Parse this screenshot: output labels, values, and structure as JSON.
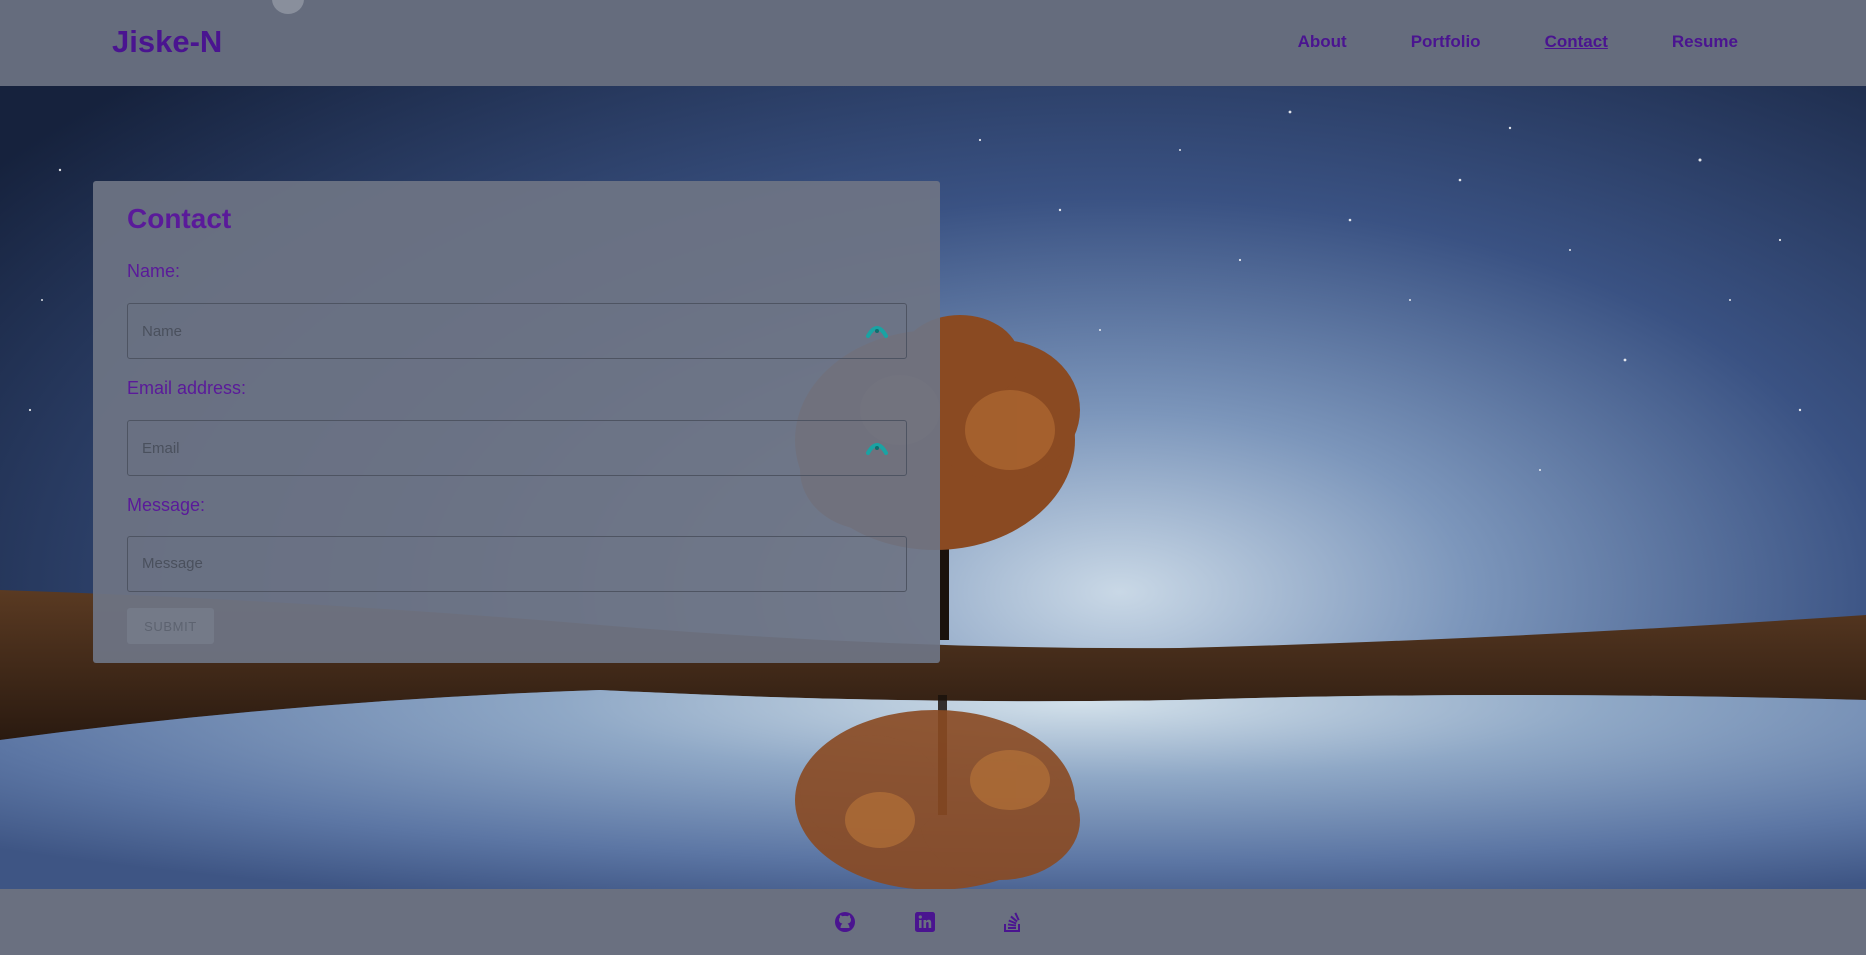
{
  "brand": {
    "name": "Jiske-N"
  },
  "nav": {
    "items": [
      {
        "label": "About"
      },
      {
        "label": "Portfolio"
      },
      {
        "label": "Contact",
        "active": true
      },
      {
        "label": "Resume"
      }
    ]
  },
  "contact": {
    "title": "Contact",
    "name_label": "Name:",
    "name_placeholder": "Name",
    "email_label": "Email address:",
    "email_placeholder": "Email",
    "message_label": "Message:",
    "message_placeholder": "Message",
    "submit_label": "SUBMIT"
  },
  "footer": {
    "icons": [
      "github-icon",
      "linkedin-icon",
      "stackoverflow-icon"
    ]
  },
  "colors": {
    "accent": "#4a1490",
    "header_bg": "#656c7d",
    "card_bg": "#6e7484",
    "footer_bg": "#6a7080",
    "field_icon": "#1aa3a3"
  }
}
